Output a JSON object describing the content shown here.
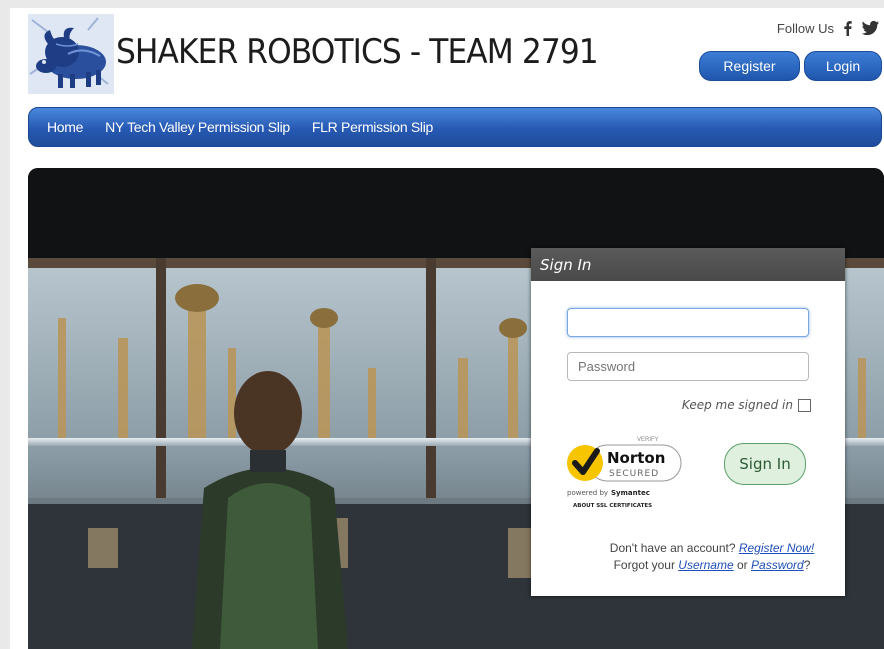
{
  "header": {
    "site_title": "SHAKER ROBOTICS - TEAM 2791",
    "follow_label": "Follow Us",
    "register_label": "Register",
    "login_label": "Login",
    "social_icons": [
      "facebook-icon",
      "twitter-icon"
    ]
  },
  "nav": {
    "items": [
      {
        "label": "Home"
      },
      {
        "label": "NY Tech Valley Permission Slip"
      },
      {
        "label": "FLR Permission Slip"
      }
    ]
  },
  "signin": {
    "title": "Sign In",
    "username_value": "",
    "password_placeholder": "Password",
    "keep_signed_in": "Keep me signed in",
    "button_label": "Sign In",
    "no_account_text": "Don't have an account?",
    "register_link": "Register Now!",
    "forgot_text": "Forgot your",
    "username_link": "Username",
    "or_text": "or",
    "password_link": "Password",
    "question_mark": "?"
  },
  "norton": {
    "verify": "VERIFY",
    "brand": "Norton",
    "secured": "SECURED",
    "powered_by": "powered by",
    "symantec": "Symantec",
    "about": "ABOUT SSL CERTIFICATES"
  },
  "colors": {
    "nav_blue": "#2759b3",
    "signin_header": "#505050",
    "signin_button_bg": "#dff0de",
    "link_blue": "#1f4fb8"
  }
}
